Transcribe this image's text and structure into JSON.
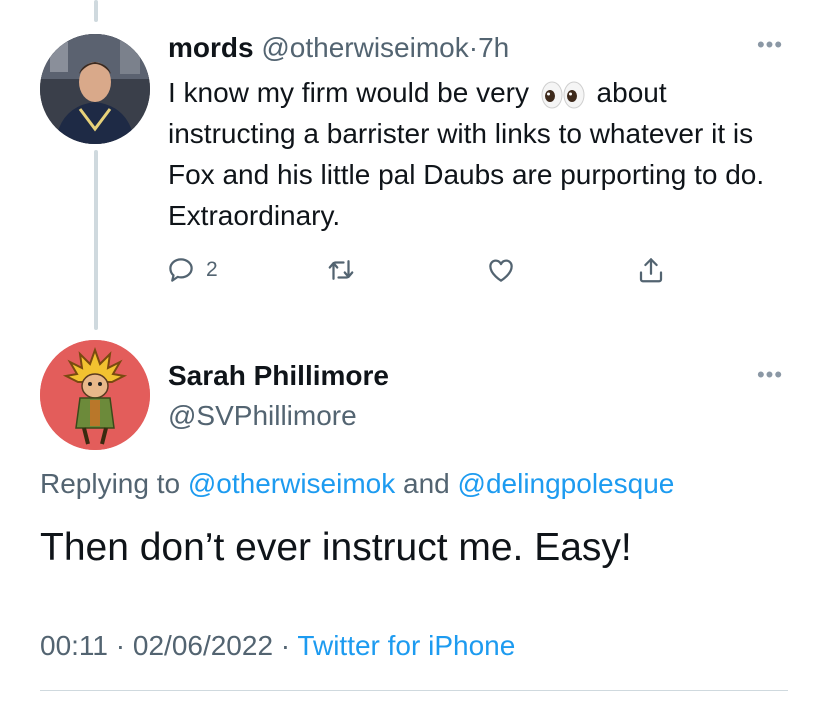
{
  "parent_tweet": {
    "name": "mords",
    "handle": "@otherwiseimok",
    "separator": "·",
    "time": "7h",
    "more_icon": "more-horizontal-icon",
    "text_before_emoji": "I know my firm would be very",
    "emoji": "eyes-emoji",
    "text_after_emoji": " about instructing a barrister with links to whatever it is Fox and his little pal Daubs are purporting to do. Extraordinary.",
    "reply_count": "2",
    "actions": [
      "reply-icon",
      "retweet-icon",
      "like-icon",
      "share-icon"
    ]
  },
  "main_tweet": {
    "name": "Sarah Phillimore",
    "handle": "@SVPhillimore",
    "more_icon": "more-horizontal-icon",
    "replying_prefix": "Replying to ",
    "replying_user1": "@otherwiseimok",
    "replying_and": " and ",
    "replying_user2": "@delingpolesque",
    "text": "Then don’t ever instruct me. Easy!",
    "time": "00:11",
    "separator": " · ",
    "date": "02/06/2022",
    "source": "Twitter for iPhone"
  },
  "colors": {
    "link": "#1d9bf0",
    "secondary_text": "#536471",
    "thread_line": "#cfd9de"
  }
}
